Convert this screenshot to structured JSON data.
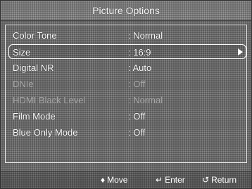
{
  "header": {
    "title": "Picture Options"
  },
  "menu": {
    "items": [
      {
        "label": "Color Tone",
        "value": ": Normal"
      },
      {
        "label": "Size",
        "value": ": 16:9"
      },
      {
        "label": "Digital NR",
        "value": ": Auto"
      },
      {
        "label": "DNIe",
        "value": ": Off"
      },
      {
        "label": "HDMI Black Level",
        "value": ": Normal"
      },
      {
        "label": "Film Mode",
        "value": ": Off"
      },
      {
        "label": "Blue Only Mode",
        "value": ": Off"
      }
    ],
    "selected_index": 1,
    "disabled_indices": [
      3,
      4
    ]
  },
  "footer": {
    "move_glyph": "♦",
    "move_label": "Move",
    "enter_glyph": "↵",
    "enter_label": "Enter",
    "return_glyph": "↺",
    "return_label": "Return"
  },
  "icons": {
    "submenu_arrow": "right-triangle-icon",
    "move": "up-down-arrows-icon",
    "enter": "enter-icon",
    "return": "return-icon"
  },
  "colors": {
    "background": "#5a5a5a",
    "text": "#ffffff",
    "disabled_text": "#a6a6a6",
    "highlight_border": "#ffffff"
  }
}
